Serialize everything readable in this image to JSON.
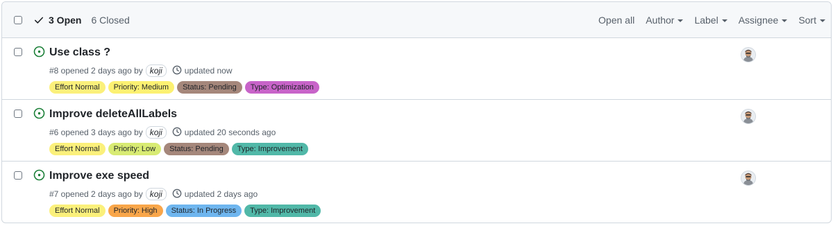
{
  "toolbar": {
    "open_label": "3 Open",
    "closed_label": "6 Closed",
    "filters": [
      "Open all",
      "Author",
      "Label",
      "Assignee",
      "Sort"
    ]
  },
  "issues": [
    {
      "title": "Use class ?",
      "opened_text": "#8 opened 2 days ago by",
      "author": "koji",
      "updated_text": "updated now",
      "labels": [
        {
          "name": "Effort Normal",
          "color": "#fbf07b"
        },
        {
          "name": "Priority: Medium",
          "color": "#fcf172"
        },
        {
          "name": "Status: Pending",
          "color": "#a5877b"
        },
        {
          "name": "Type: Optimization",
          "color": "#c864c9"
        }
      ]
    },
    {
      "title": "Improve deleteAllLabels",
      "opened_text": "#6 opened 3 days ago by",
      "author": "koji",
      "updated_text": "updated 20 seconds ago",
      "labels": [
        {
          "name": "Effort Normal",
          "color": "#fbf07b"
        },
        {
          "name": "Priority: Low",
          "color": "#d8eb73"
        },
        {
          "name": "Status: Pending",
          "color": "#a5877b"
        },
        {
          "name": "Type: Improvement",
          "color": "#51b8a8"
        }
      ]
    },
    {
      "title": "Improve exe speed",
      "opened_text": "#7 opened 2 days ago by",
      "author": "koji",
      "updated_text": "updated 2 days ago",
      "labels": [
        {
          "name": "Effort Normal",
          "color": "#fbf07b"
        },
        {
          "name": "Priority: High",
          "color": "#f9a64a"
        },
        {
          "name": "Status: In Progress",
          "color": "#6fb6ef"
        },
        {
          "name": "Type: Improvement",
          "color": "#51b8a8"
        }
      ]
    }
  ],
  "icons": {
    "open_state": "check-icon",
    "issue_status": "issue-opened-icon",
    "updated": "clock-icon",
    "assignee": "avatar"
  },
  "colors": {
    "open_issue_green": "#1a7f37",
    "header_bg": "#f6f8fa",
    "border": "#d0d7de",
    "muted_text": "#57606a"
  }
}
